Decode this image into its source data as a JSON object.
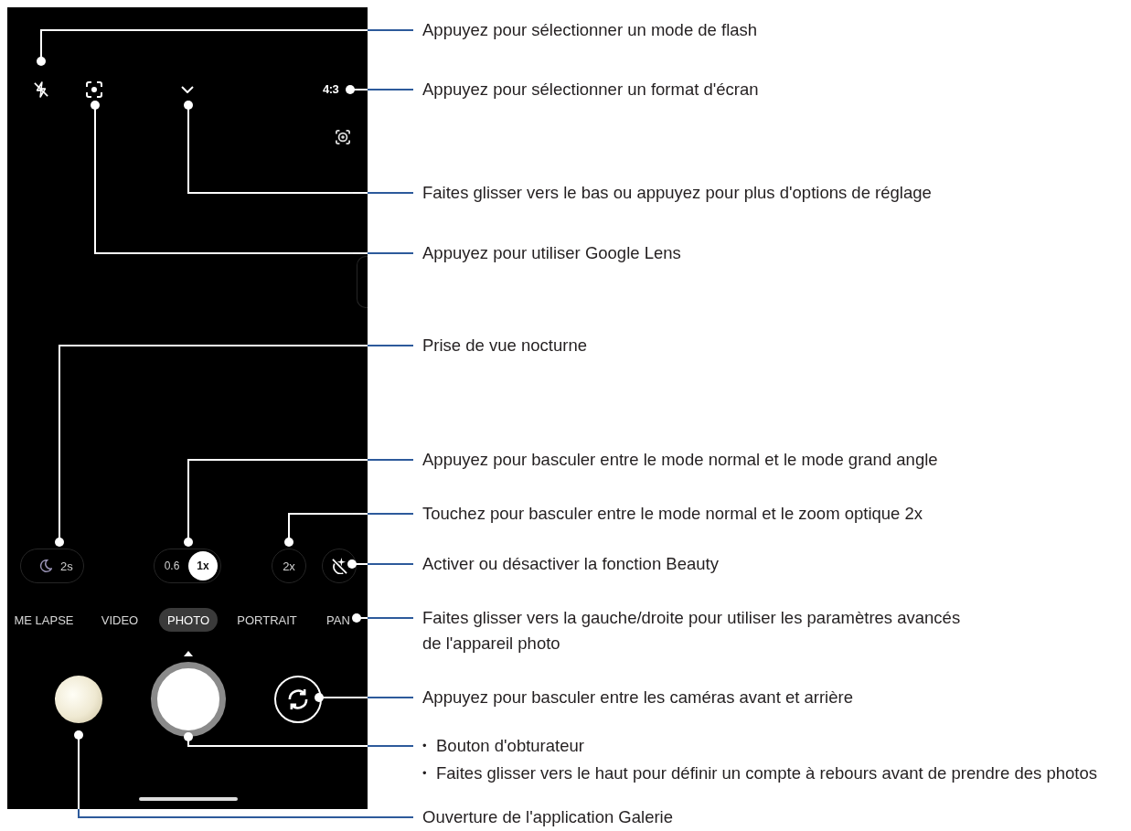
{
  "phone": {
    "aspect_ratio": "4:3",
    "night_timer": "2s",
    "lens_options": [
      {
        "label": "0.6",
        "selected": false
      },
      {
        "label": "1x",
        "selected": true
      }
    ],
    "zoom_2x": {
      "label": "2x",
      "selected": false
    },
    "modes": [
      {
        "label": "ME LAPSE",
        "selected": false
      },
      {
        "label": "VIDEO",
        "selected": false
      },
      {
        "label": "PHOTO",
        "selected": true
      },
      {
        "label": "PORTRAIT",
        "selected": false
      },
      {
        "label": "PAN",
        "selected": false
      }
    ]
  },
  "callouts": [
    {
      "kind": "flash",
      "text": "Appuyez pour sélectionner un mode de flash"
    },
    {
      "kind": "aspect",
      "text": "Appuyez pour sélectionner un format d'écran"
    },
    {
      "kind": "settings",
      "text": "Faites glisser vers le bas ou appuyez pour plus d'options de réglage"
    },
    {
      "kind": "lens",
      "text": "Appuyez pour utiliser Google Lens"
    },
    {
      "kind": "night",
      "text": "Prise de vue nocturne"
    },
    {
      "kind": "wide",
      "text": "Appuyez pour basculer entre le mode normal et le mode grand angle"
    },
    {
      "kind": "telephoto",
      "text": "Touchez pour basculer entre le mode normal et le zoom optique 2x"
    },
    {
      "kind": "beauty",
      "text": "Activer ou désactiver la fonction Beauty"
    },
    {
      "kind": "modes",
      "text": "Faites glisser vers la gauche/droite pour utiliser les paramètres avancés de l'appareil photo"
    },
    {
      "kind": "switch",
      "text": "Appuyez pour basculer entre les caméras avant et arrière"
    },
    {
      "kind": "shutter",
      "items": [
        {
          "marker": "•",
          "text": "Bouton d'obturateur"
        },
        {
          "marker": "•",
          "text": "Faites glisser vers le haut pour définir un compte à rebours avant de prendre des photos"
        }
      ]
    },
    {
      "kind": "gallery",
      "text": "Ouverture de l'application Galerie"
    }
  ]
}
